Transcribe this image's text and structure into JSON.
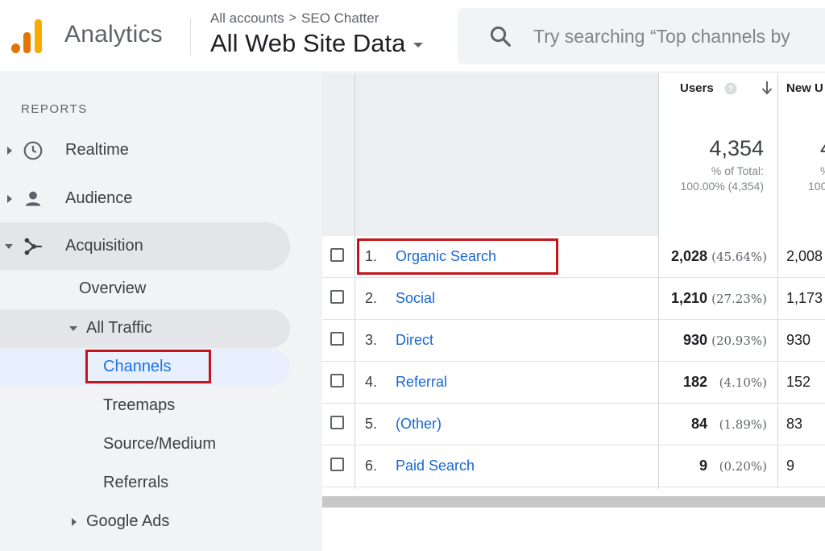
{
  "header": {
    "app_name": "Analytics",
    "breadcrumb_account": "All accounts",
    "breadcrumb_sep": ">",
    "breadcrumb_property": "SEO Chatter",
    "view_name": "All Web Site Data",
    "search_placeholder": "Try searching “Top channels by"
  },
  "brand_colors": {
    "logo_orange": "#f9ab00",
    "logo_dark_orange": "#e37400",
    "highlight_red": "#c5151a",
    "link_blue": "#1967d2"
  },
  "sidebar": {
    "heading": "REPORTS",
    "items": [
      {
        "label": "Realtime",
        "icon": "clock-icon"
      },
      {
        "label": "Audience",
        "icon": "person-icon"
      },
      {
        "label": "Acquisition",
        "icon": "acquisition-icon"
      }
    ],
    "acquisition": {
      "overview": "Overview",
      "all_traffic": "All Traffic",
      "sub_items": [
        "Channels",
        "Treemaps",
        "Source/Medium",
        "Referrals"
      ],
      "google_ads": "Google Ads"
    }
  },
  "table": {
    "headers": {
      "users": "Users",
      "new_users": "New U"
    },
    "totals": {
      "users": "4,354",
      "users_pct_label": "% of Total:",
      "users_pct_value": "100.00% (4,354)",
      "new_users_partial": "4",
      "new_users_pct_label": "%",
      "new_users_pct_value": "100.0"
    },
    "rows": [
      {
        "num": "1.",
        "channel": "Organic Search",
        "users": "2,028",
        "pct": "(45.64%)",
        "new_users": "2,008"
      },
      {
        "num": "2.",
        "channel": "Social",
        "users": "1,210",
        "pct": "(27.23%)",
        "new_users": "1,173"
      },
      {
        "num": "3.",
        "channel": "Direct",
        "users": "930",
        "pct": "(20.93%)",
        "new_users": "930"
      },
      {
        "num": "4.",
        "channel": "Referral",
        "users": "182",
        "pct": "(4.10%)",
        "new_users": "152"
      },
      {
        "num": "5.",
        "channel": "(Other)",
        "users": "84",
        "pct": "(1.89%)",
        "new_users": "83"
      },
      {
        "num": "6.",
        "channel": "Paid Search",
        "users": "9",
        "pct": "(0.20%)",
        "new_users": "9"
      }
    ]
  }
}
